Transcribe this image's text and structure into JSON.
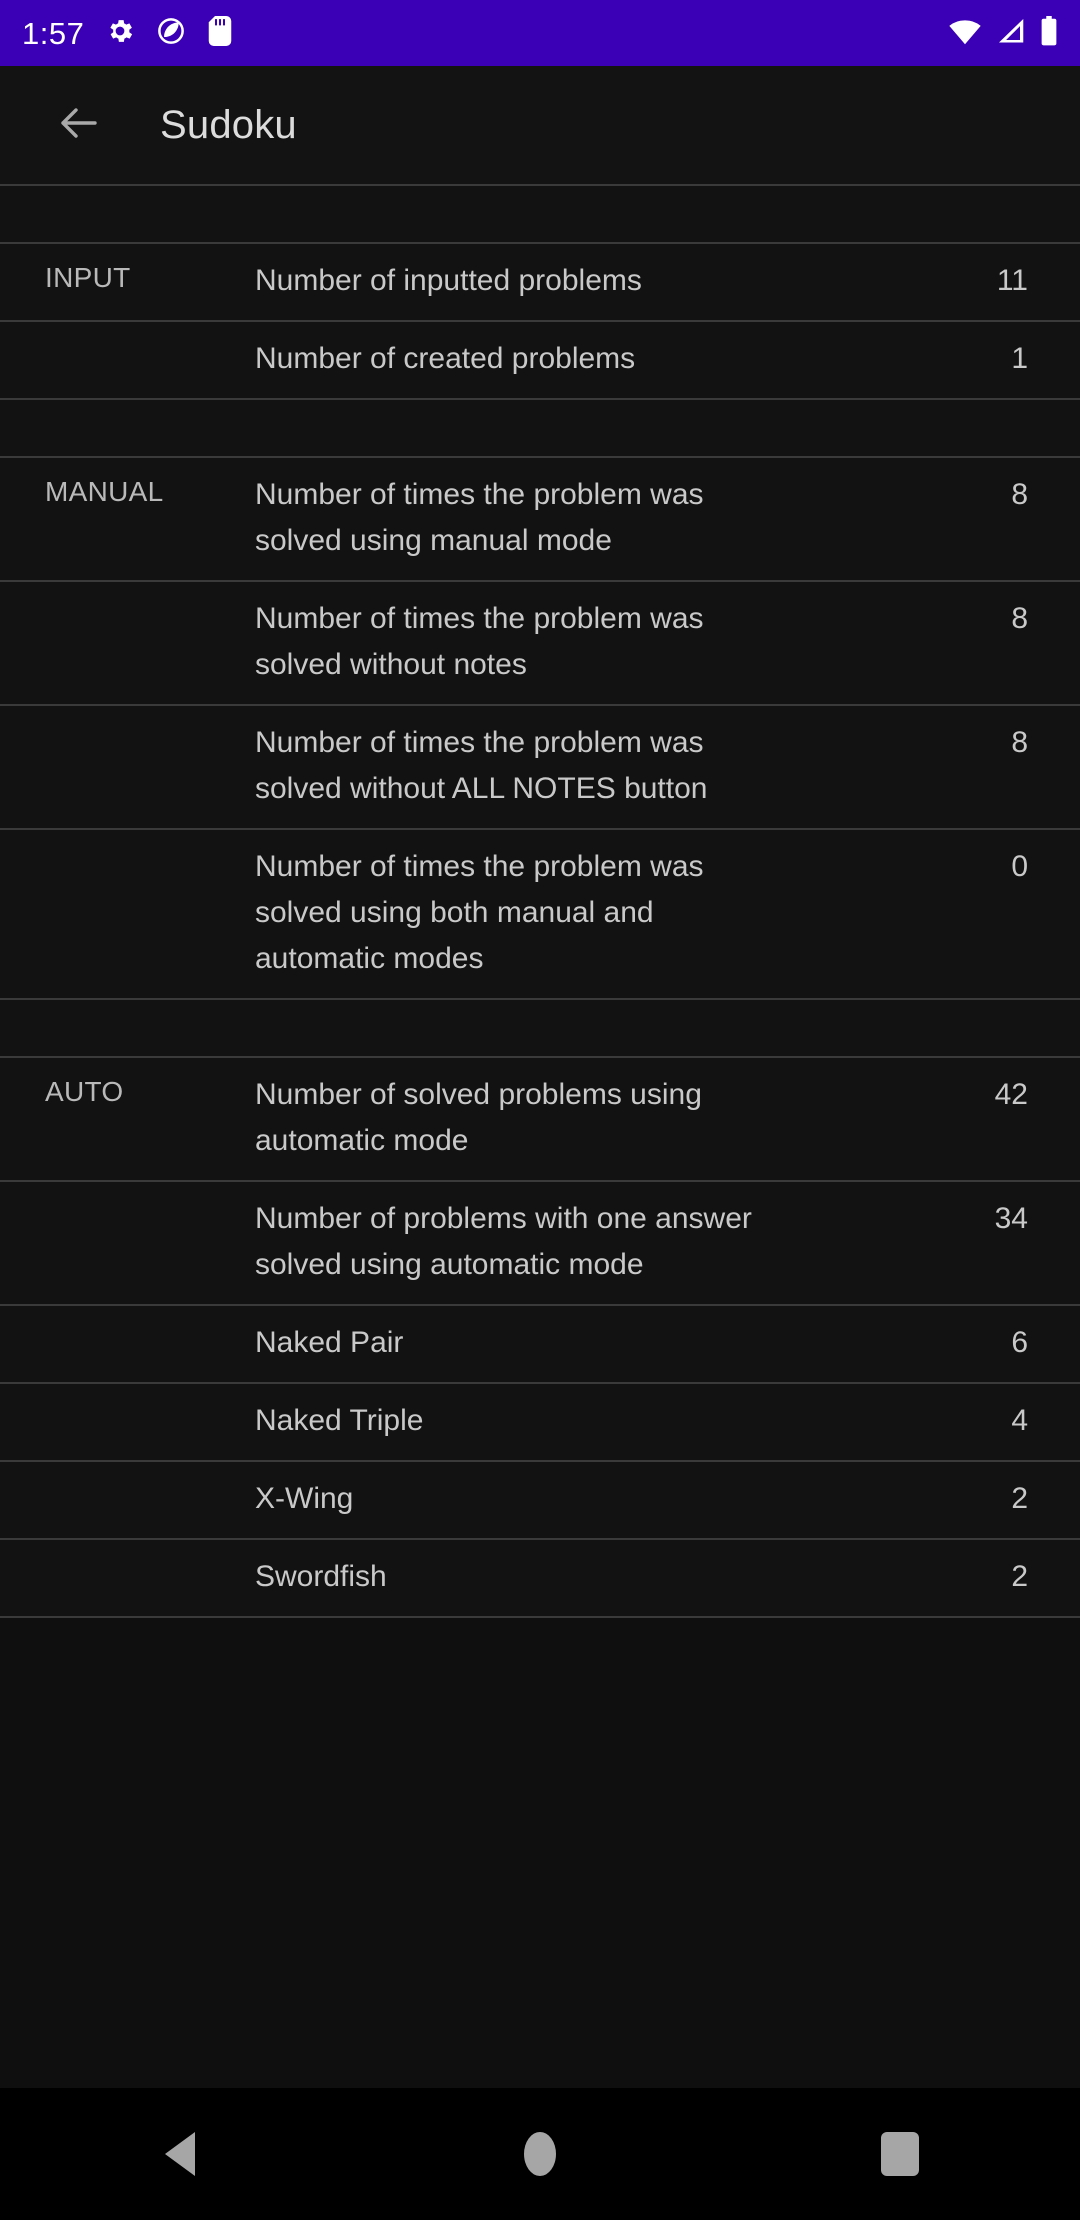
{
  "statusbar": {
    "time": "1:57",
    "left_icons": [
      "settings-gear-icon",
      "do-not-disturb-icon",
      "sd-card-icon"
    ],
    "right_icons": [
      "wifi-icon",
      "cellular-signal-icon",
      "battery-icon"
    ],
    "background_color": "#3B00B5"
  },
  "appbar": {
    "back_icon": "back-arrow-icon",
    "title": "Sudoku"
  },
  "stats": {
    "sections": [
      {
        "category": "INPUT",
        "rows": [
          {
            "label": "Number of inputted problems",
            "value": "11"
          },
          {
            "label": "Number of created problems",
            "value": "1"
          }
        ]
      },
      {
        "category": "MANUAL",
        "rows": [
          {
            "label": "Number of times the problem was solved using manual mode",
            "value": "8"
          },
          {
            "label": "Number of times the problem was solved without notes",
            "value": "8"
          },
          {
            "label": "Number of times the problem was solved without ALL NOTES button",
            "value": "8"
          },
          {
            "label": "Number of times the problem was solved using both manual and automatic modes",
            "value": "0"
          }
        ]
      },
      {
        "category": "AUTO",
        "rows": [
          {
            "label": "Number of solved problems using automatic mode",
            "value": "42"
          },
          {
            "label": "Number of problems with one answer solved using automatic mode",
            "value": "34"
          },
          {
            "label": "Naked Pair",
            "value": "6"
          },
          {
            "label": "Naked Triple",
            "value": "4"
          },
          {
            "label": "X-Wing",
            "value": "2"
          },
          {
            "label": "Swordfish",
            "value": "2"
          }
        ]
      }
    ]
  },
  "navbar": {
    "back_label": "back-triangle-icon",
    "home_label": "home-circle-icon",
    "recents_label": "recents-square-icon"
  }
}
